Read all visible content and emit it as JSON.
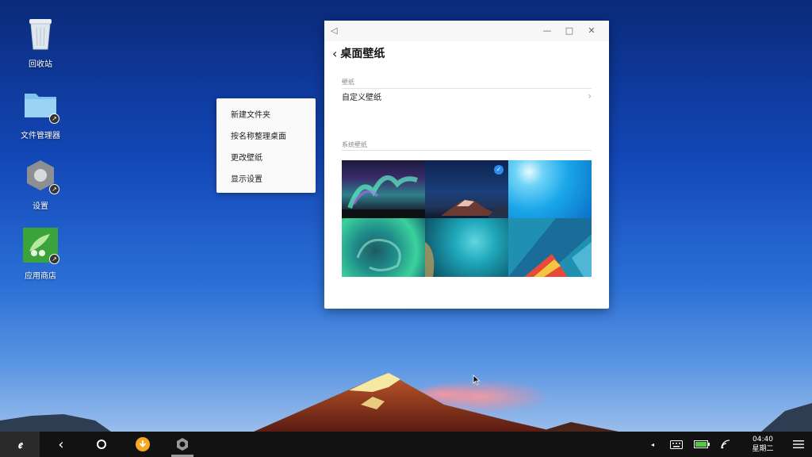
{
  "desktop": {
    "icons": [
      {
        "label": "回收站",
        "icon": "trash-icon"
      },
      {
        "label": "文件管理器",
        "icon": "folder-icon"
      },
      {
        "label": "设置",
        "icon": "settings-gear-icon"
      },
      {
        "label": "应用商店",
        "icon": "app-store-icon"
      }
    ]
  },
  "context_menu": {
    "items": [
      "新建文件夹",
      "按名称整理桌面",
      "更改壁纸",
      "显示设置"
    ]
  },
  "window": {
    "title": "桌面壁纸",
    "section1_label": "壁纸",
    "custom_item": "自定义壁纸",
    "section2_label": "系统壁纸",
    "selected_index": 1,
    "wallpapers": [
      {
        "name": "aurora"
      },
      {
        "name": "mountain-night"
      },
      {
        "name": "blue-light"
      },
      {
        "name": "teal-coast"
      },
      {
        "name": "aerial-ocean"
      },
      {
        "name": "material-shapes"
      }
    ]
  },
  "taskbar": {
    "clock_time": "04:40",
    "clock_day": "星期二"
  },
  "colors": {
    "accent": "#2d8cf0",
    "taskbar": "#121212",
    "battery": "#4cd137",
    "download": "#f5a623"
  }
}
